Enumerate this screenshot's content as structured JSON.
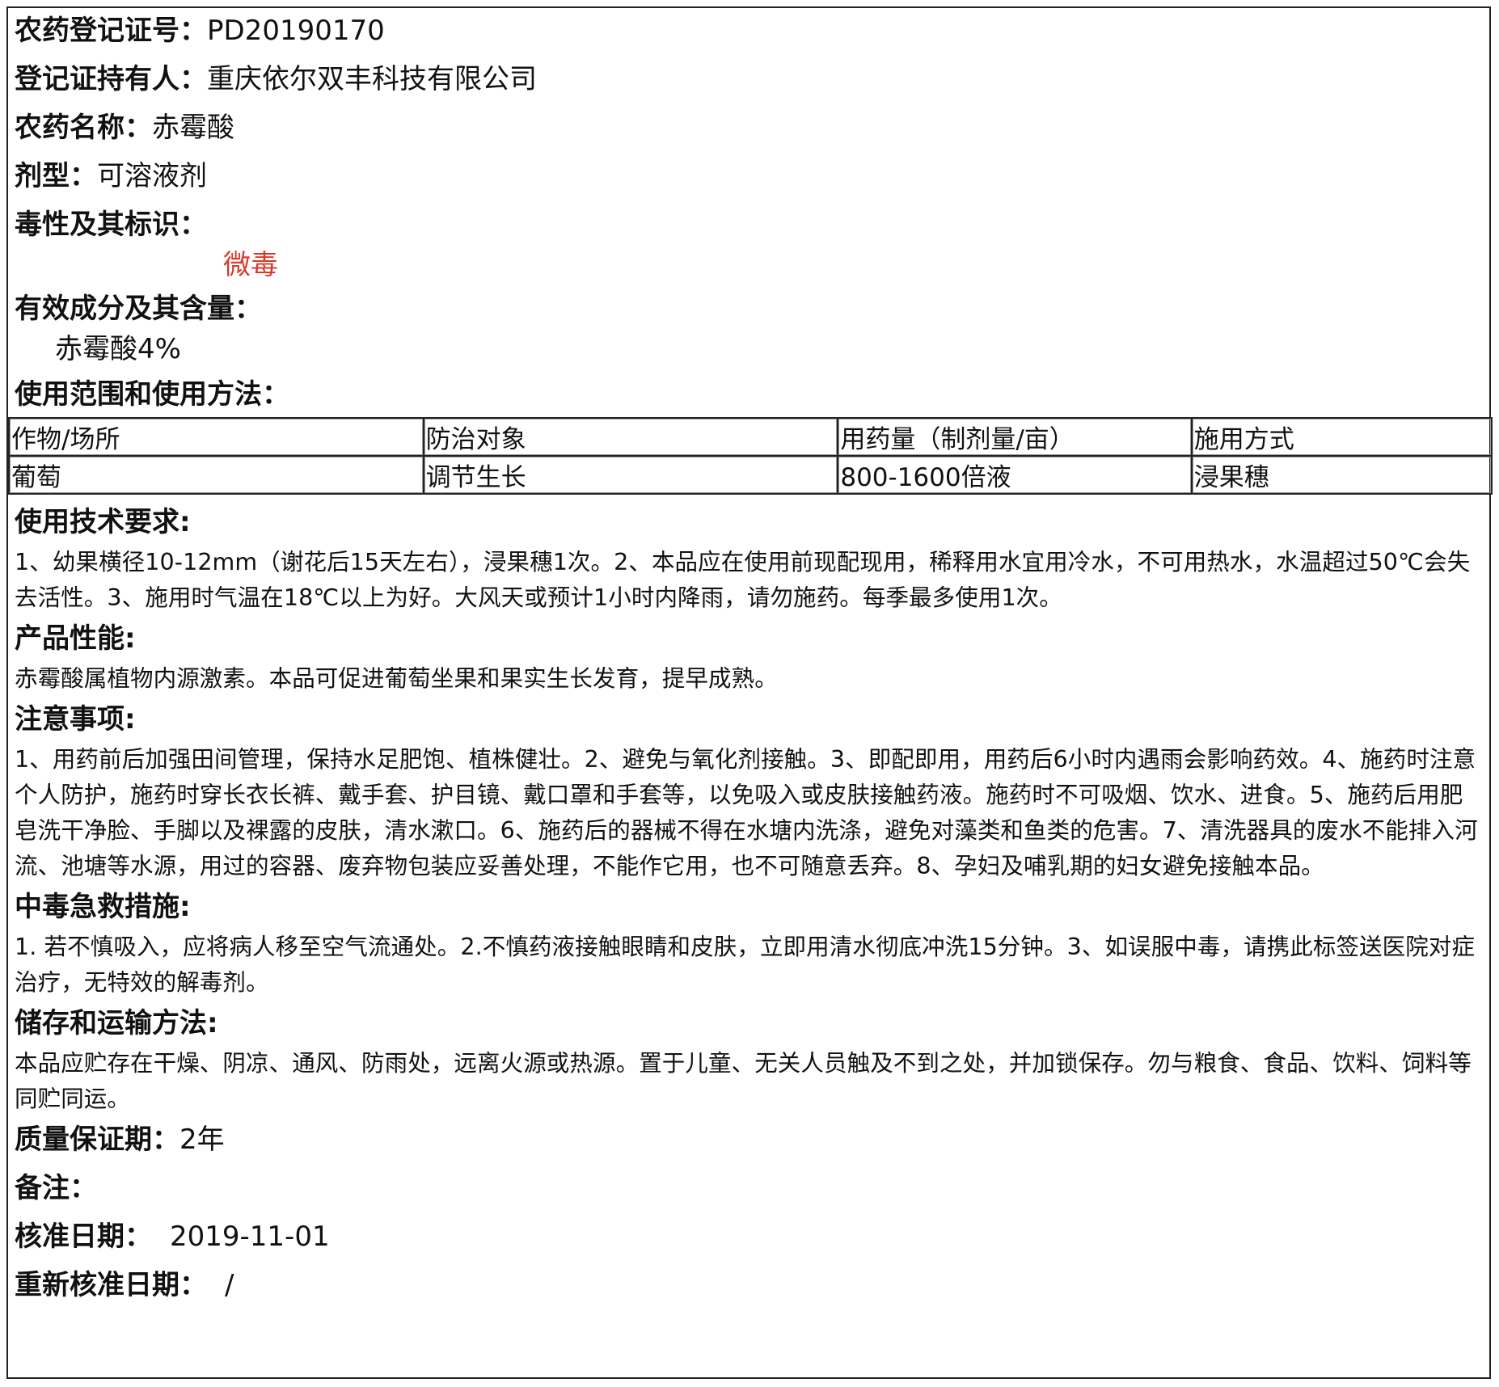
{
  "reg_no": {
    "label": "农药登记证号：",
    "value": "PD20190170"
  },
  "holder": {
    "label": "登记证持有人：",
    "value": "重庆依尔双丰科技有限公司"
  },
  "name": {
    "label": "农药名称：",
    "value": "赤霉酸"
  },
  "formulation": {
    "label": "剂型：",
    "value": "可溶液剂"
  },
  "toxicity": {
    "label": "毒性及其标识：",
    "value": "微毒",
    "color": "#d93a2b"
  },
  "ingredient": {
    "label": "有效成分及其含量：",
    "value": "赤霉酸4%"
  },
  "usage": {
    "label": "使用范围和使用方法：",
    "headers": [
      "作物/场所",
      "防治对象",
      "用药量（制剂量/亩）",
      "施用方式"
    ],
    "rows": [
      [
        "葡萄",
        "调节生长",
        "800-1600倍液",
        "浸果穗"
      ]
    ]
  },
  "tech": {
    "label": "使用技术要求:",
    "text": "1、幼果横径10-12mm（谢花后15天左右），浸果穗1次。2、本品应在使用前现配现用，稀释用水宜用冷水，不可用热水，水温超过50℃会失去活性。3、施用时气温在18℃以上为好。大风天或预计1小时内降雨，请勿施药。每季最多使用1次。"
  },
  "performance": {
    "label": "产品性能:",
    "text": "赤霉酸属植物内源激素。本品可促进葡萄坐果和果实生长发育，提早成熟。"
  },
  "notes": {
    "label": "注意事项:",
    "text": "1、用药前后加强田间管理，保持水足肥饱、植株健壮。2、避免与氧化剂接触。3、即配即用，用药后6小时内遇雨会影响药效。4、施药时注意个人防护，施药时穿长衣长裤、戴手套、护目镜、戴口罩和手套等，以免吸入或皮肤接触药液。施药时不可吸烟、饮水、进食。5、施药后用肥皂洗干净脸、手脚以及裸露的皮肤，清水漱口。6、施药后的器械不得在水塘内洗涤，避免对藻类和鱼类的危害。7、清洗器具的废水不能排入河流、池塘等水源，用过的容器、废弃物包装应妥善处理，不能作它用，也不可随意丢弃。8、孕妇及哺乳期的妇女避免接触本品。"
  },
  "firstaid": {
    "label": "中毒急救措施:",
    "text": "1. 若不慎吸入，应将病人移至空气流通处。2.不慎药液接触眼睛和皮肤，立即用清水彻底冲洗15分钟。3、如误服中毒，请携此标签送医院对症治疗，无特效的解毒剂。"
  },
  "storage": {
    "label": "储存和运输方法:",
    "text": "本品应贮存在干燥、阴凉、通风、防雨处，远离火源或热源。置于儿童、无关人员触及不到之处，并加锁保存。勿与粮食、食品、饮料、饲料等同贮同运。"
  },
  "shelf": {
    "label": "质量保证期：",
    "value": "2年"
  },
  "remark": {
    "label": "备注：",
    "value": ""
  },
  "approval": {
    "label": "核准日期：",
    "value": "2019-11-01"
  },
  "reapproval": {
    "label": "重新核准日期：",
    "value": "/"
  }
}
